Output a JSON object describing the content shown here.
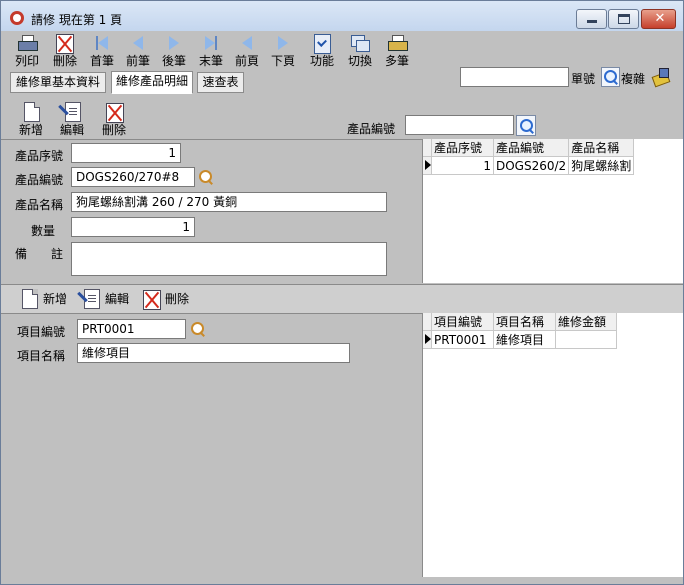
{
  "window": {
    "title": "請修  現在第 1 頁"
  },
  "toolbar": {
    "print": "列印",
    "delete": "刪除",
    "first": "首筆",
    "prev": "前筆",
    "next": "後筆",
    "last": "末筆",
    "prev_page": "前頁",
    "next_page": "下頁",
    "function": "功能",
    "switch": "切換",
    "multi": "多筆",
    "single_label": "單號",
    "copy_label": "複雜",
    "single_value": ""
  },
  "tabs": [
    "維修單基本資料",
    "維修產品明細",
    "速查表"
  ],
  "active_tab": 1,
  "product_toolbar": {
    "add": "新增",
    "edit": "編輯",
    "delete": "刪除",
    "search_label": "產品編號",
    "search_value": ""
  },
  "product_form": {
    "seq_label": "產品序號",
    "seq_value": "1",
    "code_label": "產品編號",
    "code_value": "DOGS260/270#8",
    "name_label": "產品名稱",
    "name_value": "狗尾螺絲割溝  260 / 270 黃銅",
    "qty_label": "數量",
    "qty_value": "1",
    "note_label": "備　　註",
    "note_value": ""
  },
  "product_grid": {
    "headers": [
      "產品序號",
      "產品編號",
      "產品名稱"
    ],
    "rows": [
      [
        "1",
        "DOGS260/2",
        "狗尾螺絲割"
      ]
    ]
  },
  "item_toolbar": {
    "add": "新增",
    "edit": "編輯",
    "delete": "刪除"
  },
  "item_form": {
    "code_label": "項目編號",
    "code_value": "PRT0001",
    "name_label": "項目名稱",
    "name_value": "維修項目"
  },
  "item_grid": {
    "headers": [
      "項目編號",
      "項目名稱",
      "維修金額"
    ],
    "rows": [
      [
        "PRT0001",
        "維修項目",
        ""
      ]
    ]
  }
}
